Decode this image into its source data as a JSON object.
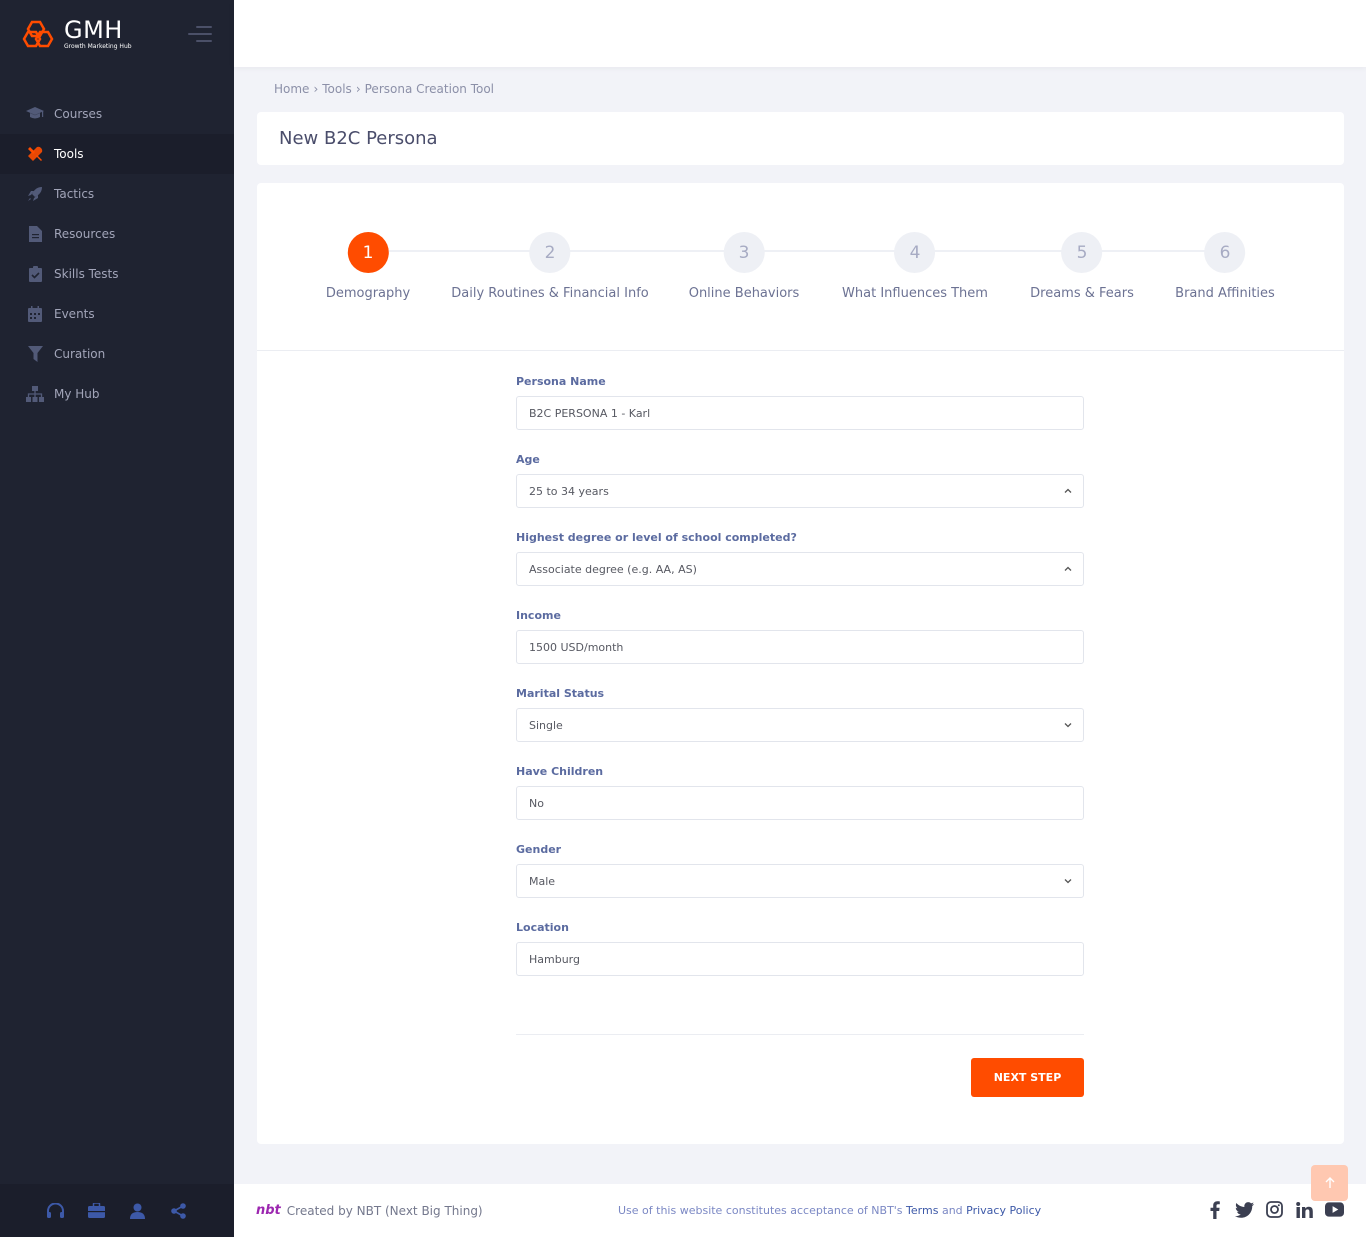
{
  "brand": {
    "name": "GMH",
    "tagline": "Growth Marketing Hub",
    "accent": "#ff4c00"
  },
  "sidebar": {
    "items": [
      {
        "label": "Courses",
        "icon": "graduation-cap-icon"
      },
      {
        "label": "Tools",
        "icon": "tools-icon",
        "active": true
      },
      {
        "label": "Tactics",
        "icon": "rocket-icon"
      },
      {
        "label": "Resources",
        "icon": "document-icon"
      },
      {
        "label": "Skills Tests",
        "icon": "clipboard-check-icon"
      },
      {
        "label": "Events",
        "icon": "calendar-icon"
      },
      {
        "label": "Curation",
        "icon": "filter-icon"
      },
      {
        "label": "My Hub",
        "icon": "sitemap-icon"
      }
    ],
    "footer_icons": [
      "headset-icon",
      "briefcase-icon",
      "user-icon",
      "share-icon"
    ]
  },
  "breadcrumb": {
    "home": "Home",
    "tools": "Tools",
    "current": "Persona Creation Tool"
  },
  "page": {
    "title": "New B2C Persona"
  },
  "steps": [
    {
      "num": "1",
      "label": "Demography",
      "active": true
    },
    {
      "num": "2",
      "label": "Daily Routines & Financial Info"
    },
    {
      "num": "3",
      "label": "Online Behaviors"
    },
    {
      "num": "4",
      "label": "What Influences Them"
    },
    {
      "num": "5",
      "label": "Dreams & Fears"
    },
    {
      "num": "6",
      "label": "Brand Affinities"
    }
  ],
  "form": {
    "persona_name": {
      "label": "Persona Name",
      "value": "B2C PERSONA 1 - Karl"
    },
    "age": {
      "label": "Age",
      "value": "25 to 34 years"
    },
    "education": {
      "label": "Highest degree or level of school completed?",
      "value": "Associate degree (e.g. AA, AS)"
    },
    "income": {
      "label": "Income",
      "value": "1500 USD/month"
    },
    "marital_status": {
      "label": "Marital Status",
      "value": "Single"
    },
    "children": {
      "label": "Have Children",
      "value": "No"
    },
    "gender": {
      "label": "Gender",
      "value": "Male"
    },
    "location": {
      "label": "Location",
      "value": "Hamburg"
    },
    "next_label": "NEXT STEP"
  },
  "footer": {
    "logo": "nbt",
    "created_by": "Created by",
    "company": "NBT (Next Big Thing)",
    "terms_prefix": "Use of this website constitutes acceptance of NBT's",
    "terms_link": "Terms",
    "and": "and",
    "privacy_link": "Privacy Policy",
    "social": [
      "facebook-icon",
      "twitter-icon",
      "instagram-icon",
      "linkedin-icon",
      "youtube-icon"
    ]
  }
}
